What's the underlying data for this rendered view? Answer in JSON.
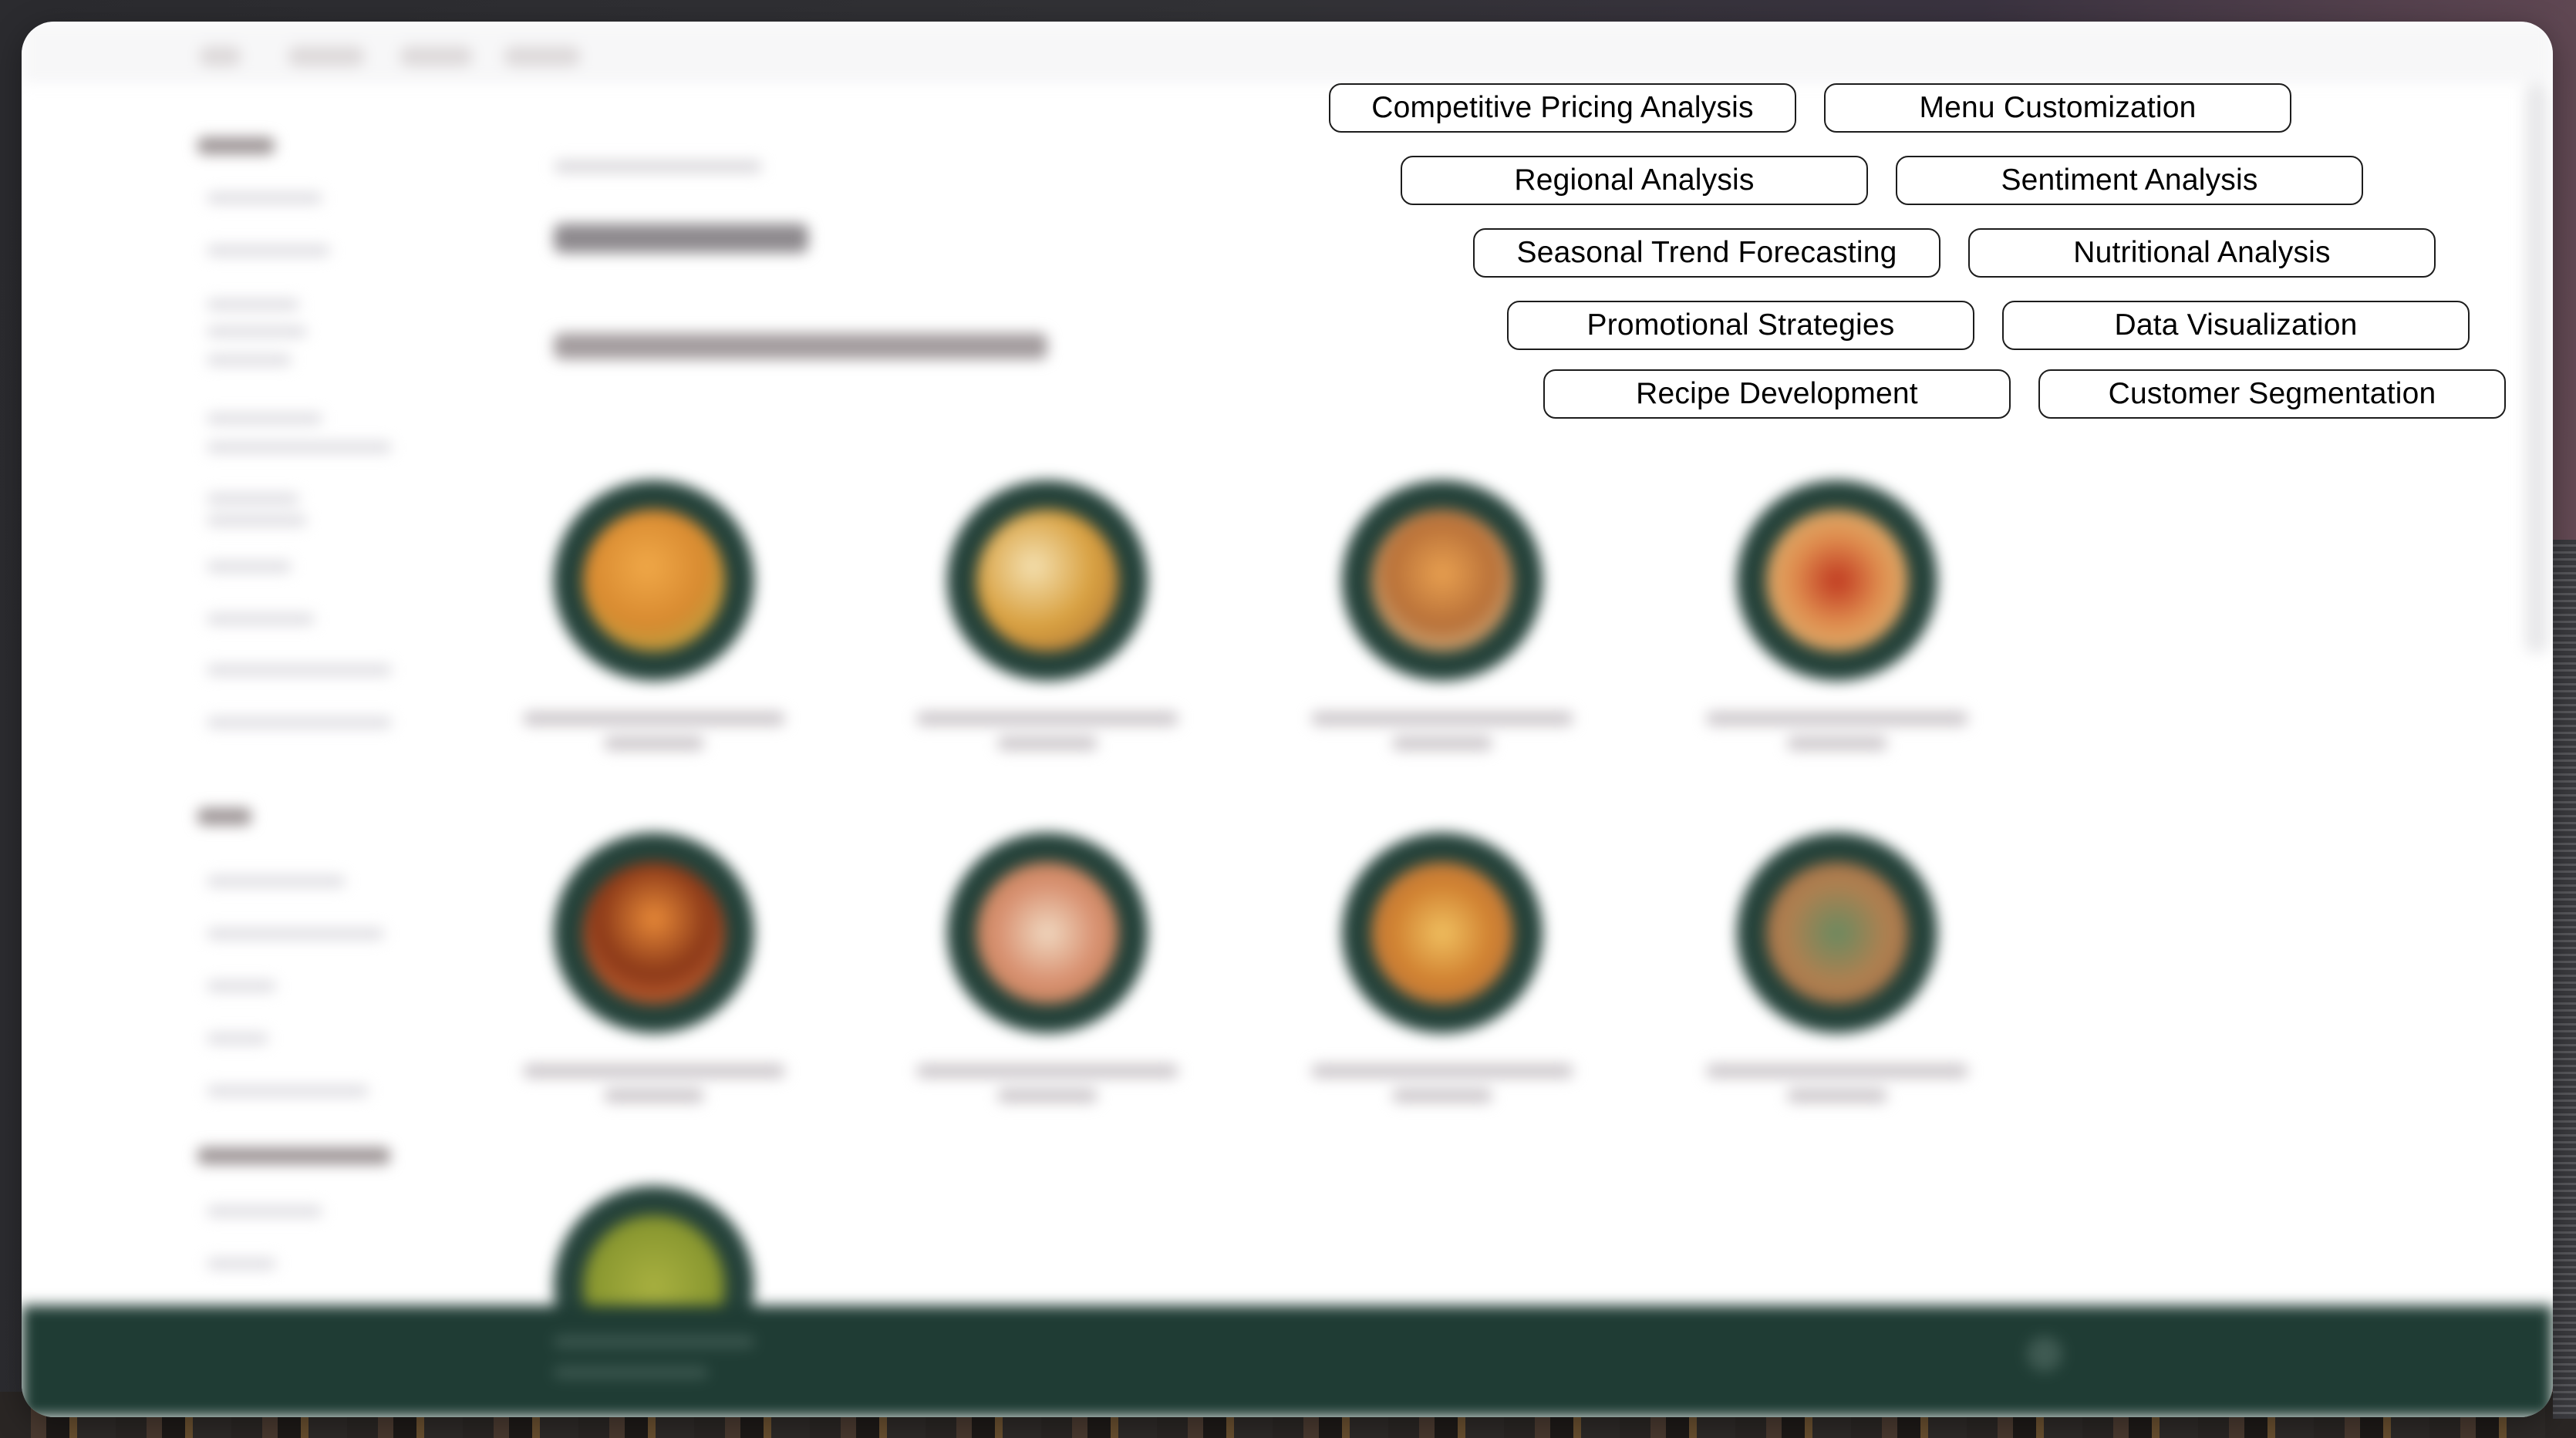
{
  "tags": [
    {
      "label": "Competitive Pricing Analysis"
    },
    {
      "label": "Menu Customization"
    },
    {
      "label": "Regional Analysis"
    },
    {
      "label": "Sentiment Analysis"
    },
    {
      "label": "Seasonal Trend Forecasting"
    },
    {
      "label": "Nutritional Analysis"
    },
    {
      "label": "Promotional Strategies"
    },
    {
      "label": "Data Visualization"
    },
    {
      "label": "Recipe Development"
    },
    {
      "label": "Customer Segmentation"
    }
  ],
  "colors": {
    "footer_bg": "#1f3c34",
    "plate_bg": "#25423a",
    "tag_border": "#1c1c1c"
  },
  "products": [
    {
      "image": "food-breakfast-sandwich"
    },
    {
      "image": "food-breakfast-sandwich"
    },
    {
      "image": "food-breakfast-sandwich"
    },
    {
      "image": "food-breakfast-sandwich"
    },
    {
      "image": "food-breakfast-sandwich"
    },
    {
      "image": "food-breakfast-sandwich"
    },
    {
      "image": "food-breakfast-sandwich"
    },
    {
      "image": "food-breakfast-wrap"
    },
    {
      "image": "food-avocado"
    }
  ]
}
